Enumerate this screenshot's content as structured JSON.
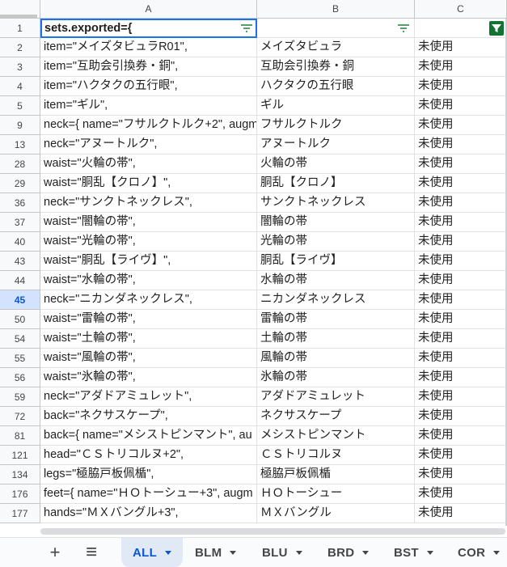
{
  "columns": [
    "A",
    "B",
    "C"
  ],
  "header_row": {
    "num": "1",
    "a": "sets.exported={",
    "b": "",
    "c": ""
  },
  "rows": [
    {
      "num": "2",
      "a": "item=\"メイズタビュラR01\",",
      "b": "メイズタビュラ",
      "c": "未使用"
    },
    {
      "num": "3",
      "a": "item=\"互助会引換券・銅\",",
      "b": "互助会引換券・銅",
      "c": "未使用"
    },
    {
      "num": "4",
      "a": "item=\"ハクタクの五行眼\",",
      "b": "ハクタクの五行眼",
      "c": "未使用"
    },
    {
      "num": "5",
      "a": "item=\"ギル\",",
      "b": "ギル",
      "c": "未使用"
    },
    {
      "num": "9",
      "a": "neck={ name=\"フサルクトルク+2\", augm",
      "b": "フサルクトルク",
      "c": "未使用"
    },
    {
      "num": "13",
      "a": "neck=\"アヌートルク\",",
      "b": "アヌートルク",
      "c": "未使用"
    },
    {
      "num": "28",
      "a": "waist=\"火輪の帯\",",
      "b": "火輪の帯",
      "c": "未使用"
    },
    {
      "num": "29",
      "a": "waist=\"胴乱【クロノ】\",",
      "b": "胴乱【クロノ】",
      "c": "未使用"
    },
    {
      "num": "36",
      "a": "neck=\"サンクトネックレス\",",
      "b": "サンクトネックレス",
      "c": "未使用"
    },
    {
      "num": "37",
      "a": "waist=\"闇輪の帯\",",
      "b": "闇輪の帯",
      "c": "未使用"
    },
    {
      "num": "40",
      "a": "waist=\"光輪の帯\",",
      "b": "光輪の帯",
      "c": "未使用"
    },
    {
      "num": "43",
      "a": "waist=\"胴乱【ライヴ】\",",
      "b": "胴乱【ライヴ】",
      "c": "未使用"
    },
    {
      "num": "44",
      "a": "waist=\"水輪の帯\",",
      "b": "水輪の帯",
      "c": "未使用"
    },
    {
      "num": "45",
      "a": "neck=\"ニカンダネックレス\",",
      "b": "ニカンダネックレス",
      "c": "未使用",
      "selected": true
    },
    {
      "num": "50",
      "a": "waist=\"雷輪の帯\",",
      "b": "雷輪の帯",
      "c": "未使用"
    },
    {
      "num": "54",
      "a": "waist=\"土輪の帯\",",
      "b": "土輪の帯",
      "c": "未使用"
    },
    {
      "num": "55",
      "a": "waist=\"風輪の帯\",",
      "b": "風輪の帯",
      "c": "未使用"
    },
    {
      "num": "56",
      "a": "waist=\"氷輪の帯\",",
      "b": "氷輪の帯",
      "c": "未使用"
    },
    {
      "num": "59",
      "a": "neck=\"アダドアミュレット\",",
      "b": "アダドアミュレット",
      "c": "未使用"
    },
    {
      "num": "72",
      "a": "back=\"ネクサスケープ\",",
      "b": "ネクサスケープ",
      "c": "未使用"
    },
    {
      "num": "81",
      "a": "back={ name=\"メシストピンマント\", au",
      "b": "メシストピンマント",
      "c": "未使用"
    },
    {
      "num": "121",
      "a": "head=\"ＣＳトリコルヌ+2\",",
      "b": "ＣＳトリコルヌ",
      "c": "未使用"
    },
    {
      "num": "134",
      "a": "legs=\"極脇戸板佩楯\",",
      "b": "極脇戸板佩楯",
      "c": "未使用"
    },
    {
      "num": "176",
      "a": "feet={ name=\"ＨＯトーシュー+3\", augm",
      "b": "ＨＯトーシュー",
      "c": "未使用"
    },
    {
      "num": "177",
      "a": "hands=\"ＭＸバングル+3\",",
      "b": "ＭＸバングル",
      "c": "未使用"
    }
  ],
  "tabs": [
    {
      "label": "ALL",
      "active": true
    },
    {
      "label": "BLM"
    },
    {
      "label": "BLU"
    },
    {
      "label": "BRD"
    },
    {
      "label": "BST"
    },
    {
      "label": "COR"
    }
  ],
  "toolbar": {
    "add_icon": "plus-icon",
    "menu_icon": "hamburger-icon",
    "add_glyph": "+",
    "menu_glyph": "≡"
  },
  "colors": {
    "selected_row": "#d3e3fd",
    "filter_active": "#137333",
    "active_tab": "#0b57d0"
  }
}
